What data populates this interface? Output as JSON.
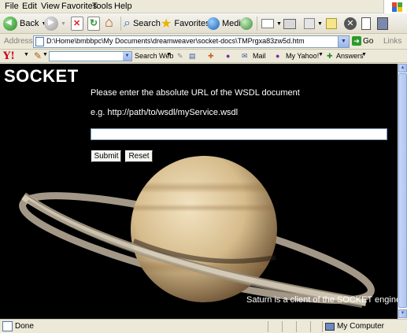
{
  "menu": [
    "File",
    "Edit",
    "View",
    "Favorites",
    "Tools",
    "Help"
  ],
  "toolbar": {
    "back_label": "Back",
    "search_label": "Search",
    "favorites_label": "Favorites",
    "media_label": "Media"
  },
  "address": {
    "label": "Address",
    "value": "D:\\Home\\bmbbpc\\My Documents\\dreamweaver\\socket-docs\\TMPrgxa83zw5d.htm",
    "go_label": "Go",
    "links_label": "Links"
  },
  "yahoo": {
    "logo": "Y!",
    "search_web_label": "Search Web",
    "mail_label": "Mail",
    "my_yahoo_label": "My Yahoo!",
    "answers_label": "Answers"
  },
  "page": {
    "title": "SOCKET",
    "prompt": "Please enter the absolute URL of the WSDL document",
    "example": "e.g. http://path/to/wsdl/myService.wsdl",
    "url_value": "",
    "submit_label": "Submit",
    "reset_label": "Reset",
    "caption": "Saturn is a client of the SOCKET engine."
  },
  "status": {
    "text": "Done",
    "zone": "My Computer"
  }
}
